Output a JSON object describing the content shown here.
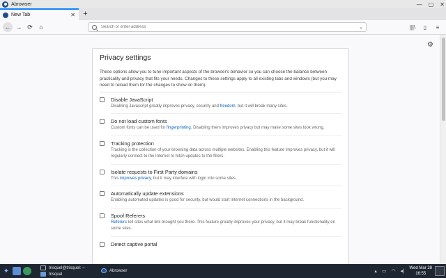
{
  "window": {
    "title": "Abrowser",
    "min_glyph": "—",
    "max_glyph": "▢",
    "close_glyph": "✕"
  },
  "tabs": [
    {
      "label": "New Tab",
      "close_glyph": "✕"
    }
  ],
  "new_tab_glyph": "+",
  "nav": {
    "back_glyph": "←",
    "forward_glyph": "→",
    "reload_glyph": "⟳",
    "home_glyph": "⌂",
    "url_placeholder": "Search or enter address",
    "dropdown_glyph": "⌄",
    "library_glyph": "|||\\",
    "sidebar_glyph": "▯",
    "menu_glyph": "≡"
  },
  "settings_gear_glyph": "⚙",
  "privacy": {
    "title": "Privacy settings",
    "intro": "These options allow you to tune important aspects of the browser's behavior so you can choose the balance between practicality and privacy that fits your needs. Changes to these settings apply to all existing tabs and windows (but you may need to reload them for the changes to show on them).",
    "options": [
      {
        "label": "Disable JavaScript",
        "desc_pre": "Disabling Javascript greatly improves privacy, security and ",
        "link": "freedom",
        "desc_post": ", but it will break many sites."
      },
      {
        "label": "Do not load custom fonts",
        "desc_pre": "Custom fonts can be used for ",
        "link": "fingerprinting",
        "desc_post": ". Disabling them improves privacy but may make some sites look wrong."
      },
      {
        "label": "Tracking protection",
        "desc_pre": "Tracking is the collection of your browsing data across multiple websites. Enabling this feature improves privacy, but it will regularly connect to the Internet to fetch updates to the filters.",
        "link": "",
        "desc_post": ""
      },
      {
        "label": "Isolate requests to First Party domains",
        "desc_pre": "This ",
        "link": "improves privacy",
        "desc_post": ", but it may interfere with login into some sites."
      },
      {
        "label": "Automatically update extensions",
        "desc_pre": "Enabling automated updates is good for security, but would start Internet connections in the background.",
        "link": "",
        "desc_post": ""
      },
      {
        "label": "Spoof Referers",
        "desc_pre": "",
        "link": "Referers",
        "desc_post": " tell sites what link brought you there. This feature greatly improves your privacy, but it may break functionality on some sites."
      },
      {
        "label": "Detect captive portal",
        "desc_pre": "",
        "link": "",
        "desc_post": ""
      }
    ]
  },
  "taskbar": {
    "start_glyph": "✦",
    "tasks": [
      {
        "label": "trisquel@trisquel: ~"
      },
      {
        "label": "trisqual"
      },
      {
        "label": "Abrowser"
      }
    ],
    "clock_date": "Wed Mar 28",
    "clock_time": "16:55"
  }
}
